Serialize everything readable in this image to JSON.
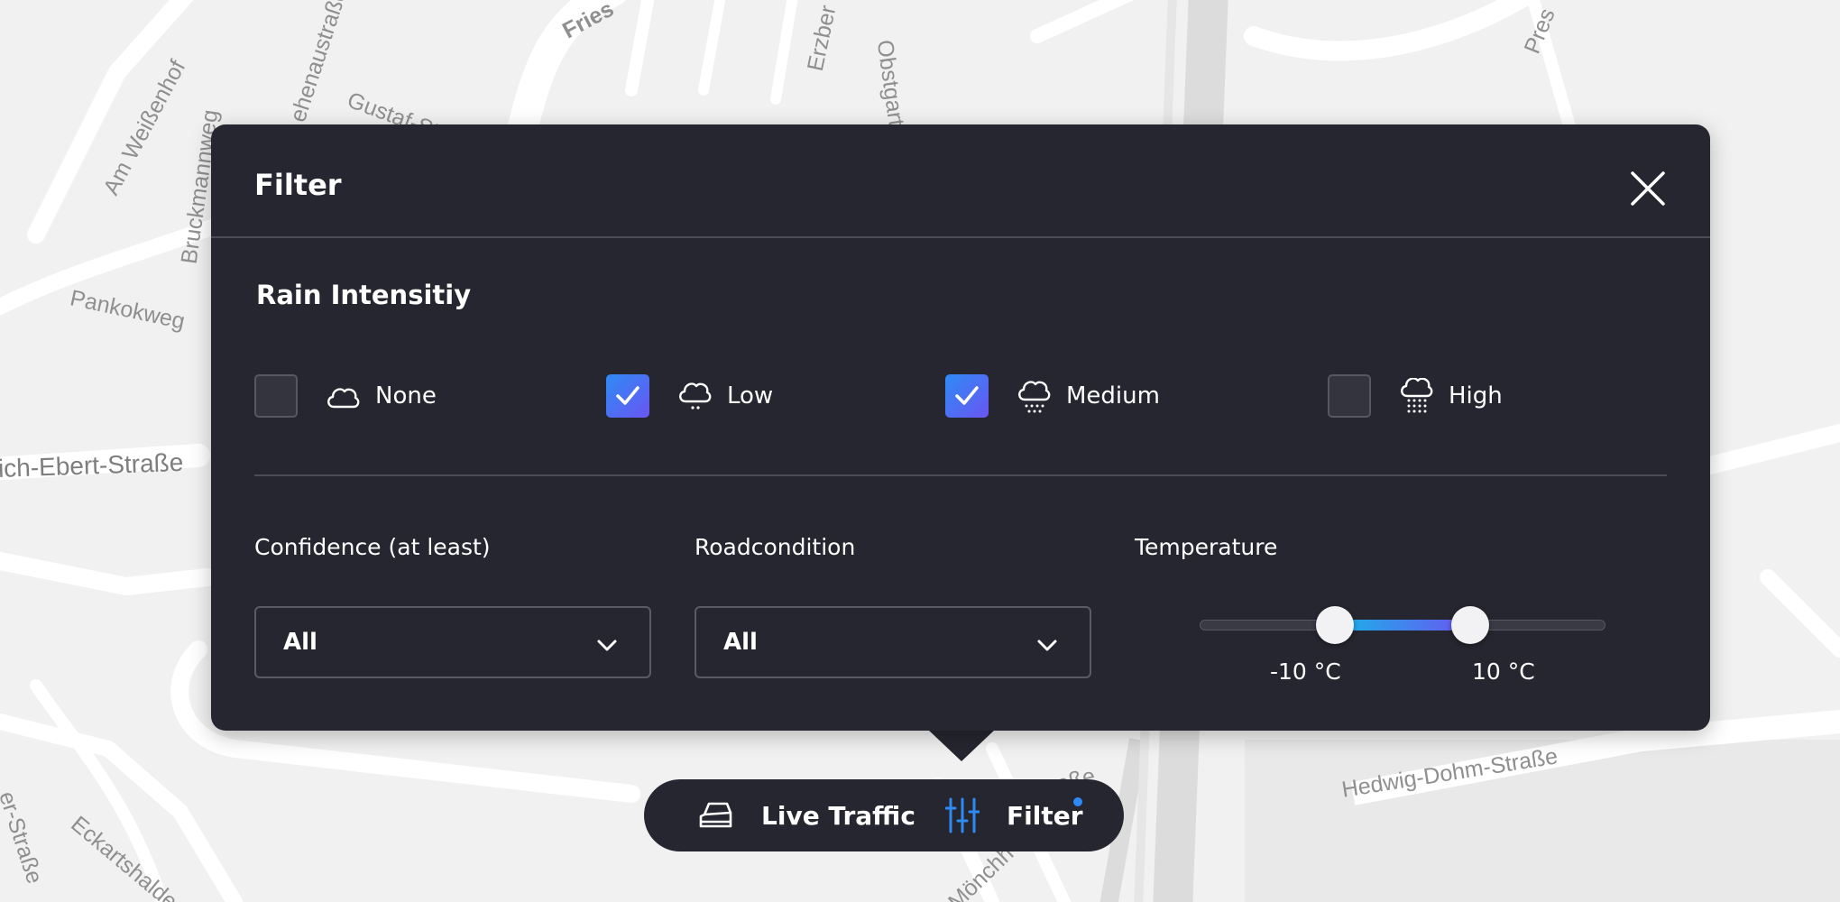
{
  "map": {
    "streets": [
      "Am Weißenhof",
      "Pankokweg",
      "Bruckmannweg",
      "Gustaf-Stotz-Weg",
      "ehenaustraße",
      "Erzber",
      "Obstgarte",
      "Fries",
      "Pres",
      "ich-Ebert-Straße",
      "Eckartshalde",
      "er-Straße",
      "Hedwig-Dohm-Straße",
      "Mönchh",
      "aße"
    ]
  },
  "dialog": {
    "title": "Filter",
    "close_icon": "close-icon",
    "rain": {
      "title": "Rain Intensitiy",
      "options": [
        {
          "label": "None",
          "checked": false,
          "icon": "cloud-icon"
        },
        {
          "label": "Low",
          "checked": true,
          "icon": "cloud-light-rain-icon"
        },
        {
          "label": "Medium",
          "checked": true,
          "icon": "cloud-medium-rain-icon"
        },
        {
          "label": "High",
          "checked": false,
          "icon": "cloud-heavy-rain-icon"
        }
      ]
    },
    "confidence": {
      "label": "Confidence (at least)",
      "value": "All"
    },
    "roadcondition": {
      "label": "Roadcondition",
      "value": "All"
    },
    "temperature": {
      "label": "Temperature",
      "min_label": "-10 °C",
      "max_label": "10 °C",
      "range_min": -30,
      "range_max": 30,
      "low": -10,
      "high": 10
    }
  },
  "bottom_bar": {
    "live_traffic": {
      "label": "Live Traffic",
      "icon": "car-icon"
    },
    "filter": {
      "label": "Filter",
      "icon": "sliders-icon",
      "has_notification": true
    }
  },
  "colors": {
    "panel": "#262630",
    "accent_blue": "#2e8bf5",
    "accent_purple": "#6a55f2",
    "accent_cyan": "#18b4e8",
    "map_bg": "#f1f1f1"
  }
}
